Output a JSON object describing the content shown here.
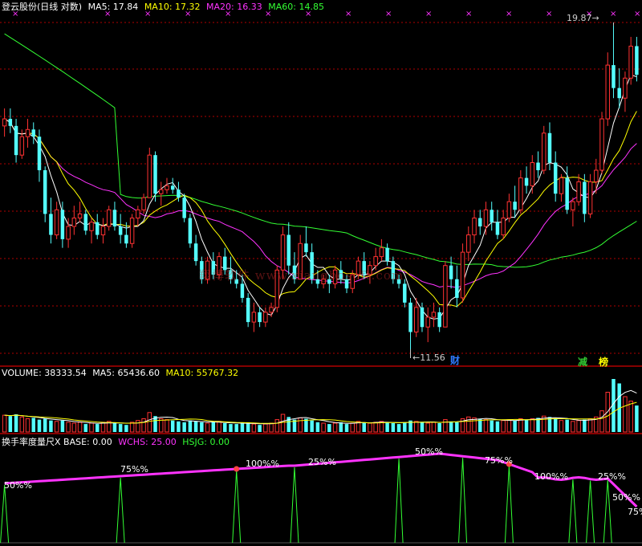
{
  "main_panel": {
    "stock_name": "登云股份(日线 对数)",
    "ma_labels": [
      {
        "text": "MA5: 17.84",
        "color": "#ffffff"
      },
      {
        "text": "MA10: 17.32",
        "color": "#ffff00"
      },
      {
        "text": "MA20: 16.33",
        "color": "#ff33ff"
      },
      {
        "text": "MA60: 14.85",
        "color": "#33ff33"
      }
    ],
    "high_label": "19.87",
    "low_label": "11.56",
    "markers": [
      {
        "text": "财",
        "color": "#2f7bff"
      },
      {
        "text": "减",
        "color": "#33cc33"
      },
      {
        "text": "榜",
        "color": "#ffff00"
      }
    ],
    "watermark": "翔博软件 www.xiangbosoft.com"
  },
  "volume_panel": {
    "labels": [
      {
        "text": "VOLUME: 38333.54",
        "color": "#ffffff"
      },
      {
        "text": "MA5: 65436.60",
        "color": "#ffffff"
      },
      {
        "text": "MA10: 55767.32",
        "color": "#ffff00"
      }
    ]
  },
  "indicator_panel": {
    "labels": [
      {
        "text": "换手率度量尺X  BASE: 0.00",
        "color": "#ffffff"
      },
      {
        "text": "WCHS: 25.00",
        "color": "#ff33ff"
      },
      {
        "text": "HSJG: 0.00",
        "color": "#33ff33"
      }
    ],
    "pct_labels": [
      "50%%",
      "75%%",
      "100%%",
      "25%%",
      "50%%",
      "75%%",
      "100%%",
      "25%%",
      "50%%",
      "75%"
    ]
  },
  "colors": {
    "up": "#ff3232",
    "down": "#54ffff",
    "ma5": "#ffffff",
    "ma10": "#ffff00",
    "ma20": "#ff33ff",
    "ma60": "#33ff33",
    "grid": "#b00000",
    "wchs": "#ff33ff",
    "hsjg": "#33ff33"
  },
  "chart_data": [
    {
      "type": "candlestick",
      "title": "登云股份(日线 对数)",
      "scale": "log",
      "ylim": [
        11.3,
        20.3
      ],
      "high": 19.87,
      "low": 11.56,
      "ohlc": [
        [
          16.8,
          17.3,
          16.5,
          17.0
        ],
        [
          17.0,
          17.3,
          16.6,
          16.8
        ],
        [
          16.8,
          17.0,
          15.8,
          16.0
        ],
        [
          16.0,
          16.7,
          15.9,
          16.5
        ],
        [
          16.5,
          17.0,
          16.2,
          16.7
        ],
        [
          16.7,
          16.9,
          16.3,
          16.5
        ],
        [
          16.5,
          16.7,
          15.3,
          15.6
        ],
        [
          15.6,
          15.7,
          14.3,
          14.5
        ],
        [
          14.5,
          14.9,
          13.8,
          14.0
        ],
        [
          14.0,
          14.8,
          13.9,
          14.6
        ],
        [
          14.6,
          14.8,
          13.7,
          13.9
        ],
        [
          13.9,
          14.4,
          13.7,
          14.2
        ],
        [
          14.2,
          14.7,
          14.0,
          14.4
        ],
        [
          14.4,
          14.8,
          14.3,
          14.5
        ],
        [
          14.5,
          14.6,
          14.0,
          14.1
        ],
        [
          14.1,
          14.4,
          13.8,
          14.3
        ],
        [
          14.3,
          14.5,
          13.9,
          14.0
        ],
        [
          14.0,
          14.4,
          13.8,
          14.2
        ],
        [
          14.2,
          14.7,
          14.1,
          14.6
        ],
        [
          14.6,
          14.8,
          14.1,
          14.2
        ],
        [
          14.2,
          14.5,
          13.8,
          14.0
        ],
        [
          14.0,
          14.3,
          13.7,
          13.8
        ],
        [
          13.8,
          14.5,
          13.7,
          14.4
        ],
        [
          14.4,
          14.7,
          14.2,
          14.6
        ],
        [
          14.6,
          15.0,
          14.5,
          14.9
        ],
        [
          14.9,
          16.2,
          14.9,
          16.0
        ],
        [
          16.0,
          16.1,
          14.8,
          15.0
        ],
        [
          15.0,
          15.3,
          14.7,
          15.1
        ],
        [
          15.1,
          15.4,
          15.0,
          15.2
        ],
        [
          15.2,
          15.4,
          15.0,
          15.1
        ],
        [
          15.1,
          15.3,
          14.8,
          14.9
        ],
        [
          14.9,
          15.0,
          14.3,
          14.4
        ],
        [
          14.4,
          14.5,
          13.7,
          13.8
        ],
        [
          13.8,
          14.0,
          13.3,
          13.4
        ],
        [
          13.4,
          13.5,
          12.9,
          13.0
        ],
        [
          13.0,
          13.5,
          12.9,
          13.4
        ],
        [
          13.4,
          13.6,
          13.0,
          13.1
        ],
        [
          13.1,
          13.6,
          13.0,
          13.5
        ],
        [
          13.5,
          13.7,
          13.1,
          13.2
        ],
        [
          13.2,
          13.5,
          12.9,
          13.0
        ],
        [
          13.0,
          13.2,
          12.8,
          12.9
        ],
        [
          12.9,
          13.1,
          12.5,
          12.6
        ],
        [
          12.6,
          12.7,
          12.0,
          12.1
        ],
        [
          12.1,
          12.5,
          11.9,
          12.3
        ],
        [
          12.3,
          12.4,
          12.0,
          12.1
        ],
        [
          12.1,
          12.4,
          12.0,
          12.3
        ],
        [
          12.3,
          12.5,
          12.2,
          12.4
        ],
        [
          12.4,
          13.3,
          12.3,
          13.2
        ],
        [
          13.2,
          14.2,
          13.0,
          14.0
        ],
        [
          14.0,
          14.3,
          13.1,
          13.3
        ],
        [
          13.3,
          13.6,
          12.9,
          13.0
        ],
        [
          13.0,
          14.0,
          13.0,
          13.8
        ],
        [
          13.8,
          14.2,
          13.5,
          13.6
        ],
        [
          13.6,
          13.8,
          12.9,
          13.0
        ],
        [
          13.0,
          13.2,
          12.8,
          12.9
        ],
        [
          12.9,
          13.1,
          12.8,
          13.0
        ],
        [
          13.0,
          13.1,
          12.7,
          12.9
        ],
        [
          12.9,
          13.3,
          12.8,
          13.2
        ],
        [
          13.2,
          13.4,
          12.9,
          13.0
        ],
        [
          13.0,
          13.1,
          12.7,
          12.8
        ],
        [
          12.8,
          13.2,
          12.7,
          13.1
        ],
        [
          13.1,
          13.5,
          13.0,
          13.4
        ],
        [
          13.4,
          13.6,
          13.0,
          13.1
        ],
        [
          13.1,
          13.4,
          12.9,
          13.3
        ],
        [
          13.3,
          13.7,
          13.2,
          13.5
        ],
        [
          13.5,
          13.9,
          13.4,
          13.7
        ],
        [
          13.7,
          13.8,
          13.3,
          13.4
        ],
        [
          13.4,
          13.5,
          12.9,
          13.0
        ],
        [
          13.0,
          13.1,
          12.8,
          12.9
        ],
        [
          12.9,
          13.0,
          12.4,
          12.5
        ],
        [
          12.5,
          12.6,
          11.56,
          11.9
        ],
        [
          11.9,
          12.6,
          11.8,
          12.4
        ],
        [
          12.4,
          12.5,
          11.9,
          12.0
        ],
        [
          12.0,
          12.4,
          11.7,
          12.2
        ],
        [
          12.2,
          12.5,
          12.0,
          12.3
        ],
        [
          12.3,
          12.4,
          11.9,
          12.0
        ],
        [
          12.0,
          13.4,
          12.0,
          13.3
        ],
        [
          13.3,
          13.5,
          12.8,
          13.0
        ],
        [
          13.0,
          13.3,
          12.4,
          12.6
        ],
        [
          12.6,
          13.8,
          12.5,
          13.6
        ],
        [
          13.6,
          14.2,
          13.4,
          14.0
        ],
        [
          14.0,
          14.6,
          13.8,
          14.4
        ],
        [
          14.4,
          14.6,
          14.0,
          14.2
        ],
        [
          14.2,
          14.8,
          14.0,
          14.6
        ],
        [
          14.6,
          14.8,
          14.1,
          14.3
        ],
        [
          14.3,
          14.6,
          13.9,
          14.0
        ],
        [
          14.0,
          14.6,
          13.9,
          14.4
        ],
        [
          14.4,
          15.0,
          14.3,
          14.8
        ],
        [
          14.8,
          15.2,
          14.4,
          14.6
        ],
        [
          14.6,
          15.6,
          14.5,
          15.4
        ],
        [
          15.4,
          15.7,
          15.0,
          15.2
        ],
        [
          15.2,
          16.0,
          15.0,
          15.8
        ],
        [
          15.8,
          16.1,
          15.4,
          15.6
        ],
        [
          15.6,
          16.8,
          15.5,
          16.6
        ],
        [
          16.6,
          16.9,
          15.6,
          15.8
        ],
        [
          15.8,
          16.1,
          14.8,
          15.0
        ],
        [
          15.0,
          15.5,
          14.8,
          15.4
        ],
        [
          15.4,
          15.7,
          14.5,
          14.6
        ],
        [
          14.6,
          14.9,
          14.2,
          14.8
        ],
        [
          14.8,
          15.5,
          14.7,
          15.3
        ],
        [
          15.3,
          15.5,
          14.3,
          14.5
        ],
        [
          14.5,
          15.5,
          14.4,
          15.3
        ],
        [
          15.3,
          15.9,
          15.0,
          15.6
        ],
        [
          15.6,
          17.2,
          15.5,
          17.0
        ],
        [
          17.0,
          19.0,
          16.8,
          18.6
        ],
        [
          18.6,
          19.87,
          17.6,
          17.9
        ],
        [
          17.9,
          18.5,
          17.3,
          17.6
        ],
        [
          17.6,
          18.4,
          17.2,
          18.2
        ],
        [
          18.2,
          19.5,
          18.0,
          19.2
        ],
        [
          19.2,
          19.5,
          18.1,
          18.3
        ]
      ]
    },
    {
      "type": "bar",
      "title": "VOLUME",
      "values": [
        38,
        36,
        40,
        34,
        30,
        32,
        28,
        30,
        26,
        24,
        26,
        22,
        20,
        22,
        18,
        20,
        18,
        22,
        24,
        20,
        18,
        16,
        22,
        26,
        30,
        44,
        36,
        30,
        28,
        26,
        24,
        22,
        26,
        24,
        22,
        20,
        22,
        24,
        20,
        18,
        18,
        20,
        22,
        18,
        16,
        18,
        20,
        28,
        40,
        34,
        28,
        32,
        30,
        26,
        22,
        20,
        18,
        20,
        22,
        18,
        20,
        24,
        22,
        20,
        22,
        24,
        22,
        20,
        18,
        22,
        26,
        24,
        22,
        20,
        22,
        20,
        28,
        24,
        22,
        30,
        34,
        32,
        30,
        28,
        26,
        24,
        26,
        28,
        26,
        30,
        28,
        30,
        32,
        36,
        34,
        30,
        26,
        28,
        24,
        26,
        28,
        30,
        34,
        48,
        90,
        120,
        110,
        80,
        70,
        60
      ],
      "ma5": 65436.6,
      "ma10": 55767.32,
      "volume": 38333.54
    },
    {
      "type": "line",
      "title": "换手率度量尺X",
      "series": [
        {
          "name": "BASE",
          "values": [
            0.0
          ]
        },
        {
          "name": "WCHS",
          "values": [
            25.0
          ]
        },
        {
          "name": "HSJG",
          "values": [
            0.0
          ]
        }
      ]
    }
  ]
}
